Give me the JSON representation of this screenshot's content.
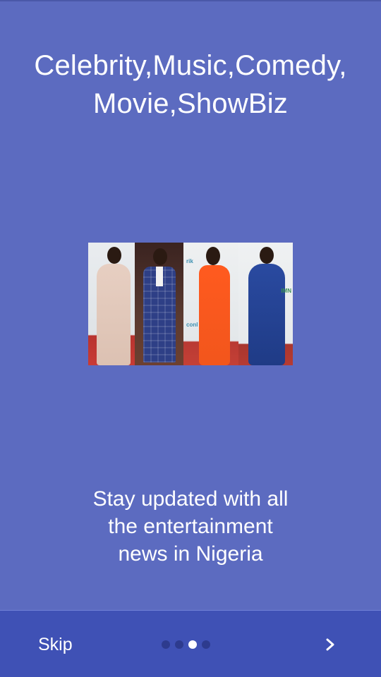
{
  "headline": {
    "line1": "Celebrity,Music,Comedy,",
    "line2": "Movie,ShowBiz"
  },
  "hero_image": {
    "brand_marks": [
      "rik",
      "IMN",
      "conl"
    ]
  },
  "subtitle": {
    "line1": "Stay updated with all",
    "line2": "the entertainment",
    "line3": "news in Nigeria"
  },
  "bottom_bar": {
    "skip_label": "Skip",
    "page_count": 4,
    "current_page": 3,
    "next_icon": "chevron-right-icon"
  },
  "colors": {
    "background": "#5c6bc0",
    "bottom_bar": "#3f51b5",
    "dot_active": "#ffffff",
    "dot_inactive": "#2a3582"
  }
}
